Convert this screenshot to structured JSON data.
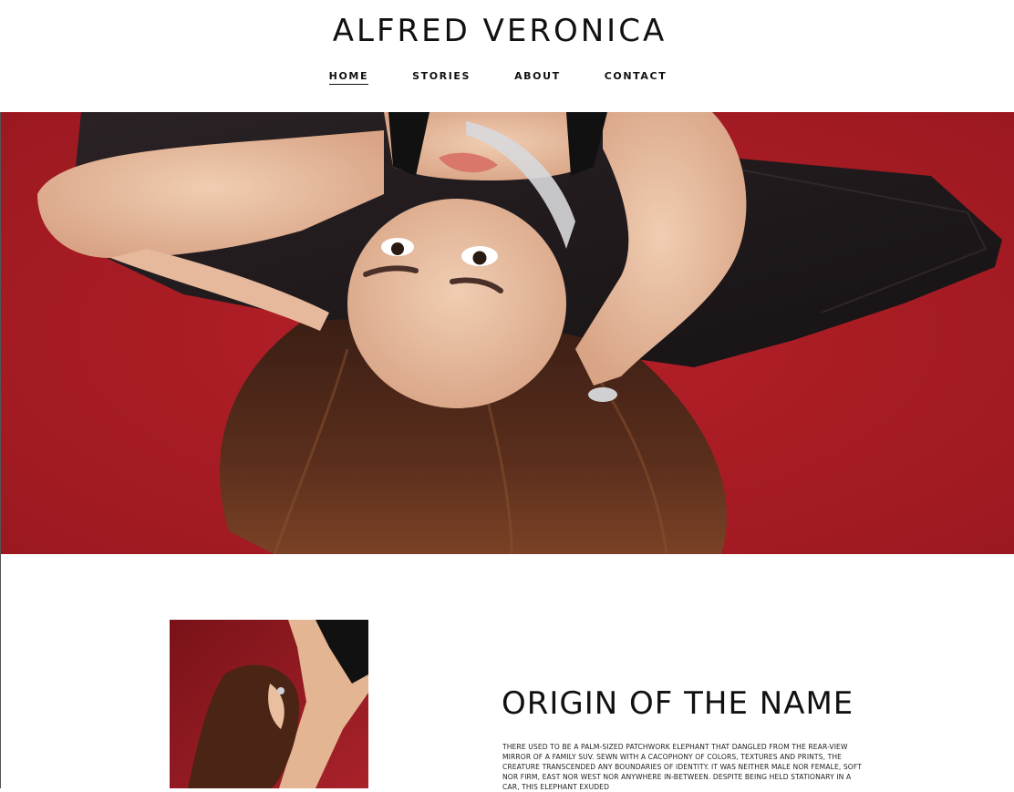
{
  "site": {
    "title": "ALFRED VERONICA"
  },
  "nav": {
    "items": [
      {
        "label": "HOME",
        "active": true
      },
      {
        "label": "STORIES",
        "active": false
      },
      {
        "label": "ABOUT",
        "active": false
      },
      {
        "label": "CONTACT",
        "active": false
      }
    ]
  },
  "origin": {
    "heading": "ORIGIN OF THE NAME",
    "body": "THERE USED TO BE A PALM-SIZED PATCHWORK ELEPHANT THAT DANGLED FROM THE REAR-VIEW MIRROR OF A FAMILY SUV. SEWN WITH A CACOPHONY OF COLORS, TEXTURES AND PRINTS, THE CREATURE TRANSCENDED ANY BOUNDARIES OF IDENTITY. IT WAS NEITHER MALE NOR FEMALE, SOFT NOR FIRM, EAST NOR WEST NOR ANYWHERE IN-BETWEEN. DESPITE BEING HELD STATIONARY IN A CAR, THIS ELEPHANT EXUDED"
  },
  "colors": {
    "hero_background": "#b01e25",
    "text": "#111111",
    "page_background": "#ffffff"
  }
}
